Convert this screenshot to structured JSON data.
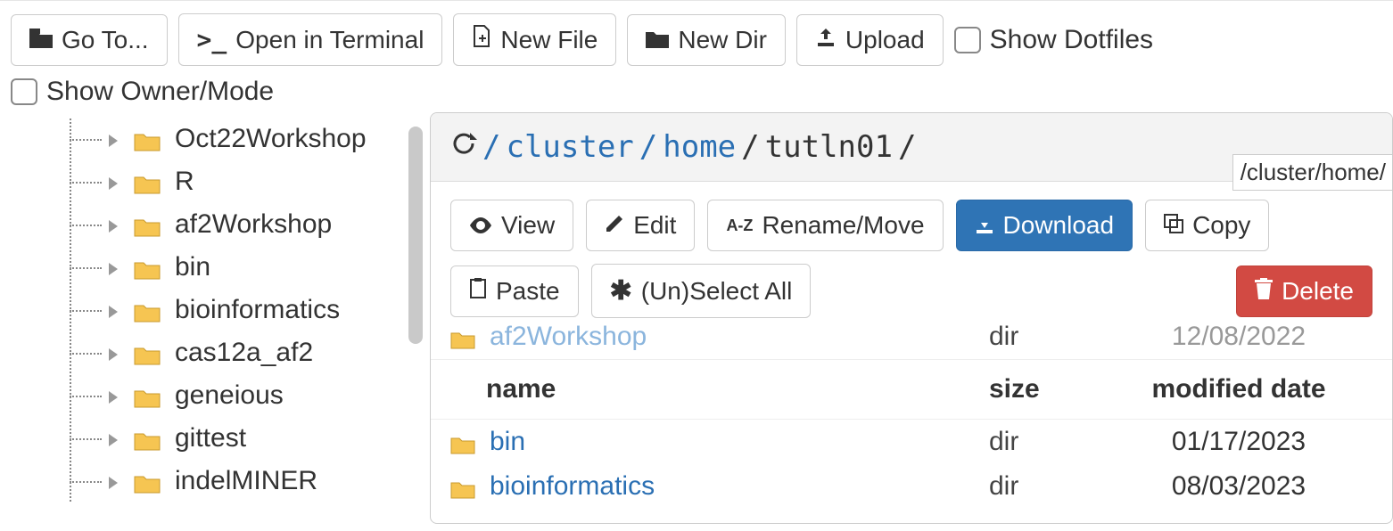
{
  "toolbar": {
    "goto": "Go To...",
    "terminal": "Open in Terminal",
    "newfile": "New File",
    "newdir": "New Dir",
    "upload": "Upload",
    "show_dotfiles": "Show Dotfiles",
    "show_ownermode": "Show Owner/Mode"
  },
  "tree": {
    "items": [
      "Oct22Workshop",
      "R",
      "af2Workshop",
      "bin",
      "bioinformatics",
      "cas12a_af2",
      "geneious",
      "gittest",
      "indelMINER"
    ]
  },
  "breadcrumb": {
    "parts": [
      "/",
      "cluster",
      "/",
      "home",
      "/",
      "tutln01",
      "/"
    ],
    "tooltip": "/cluster/home/"
  },
  "actions": {
    "view": "View",
    "edit": "Edit",
    "rename": "Rename/Move",
    "download": "Download",
    "copy": "Copy",
    "paste": "Paste",
    "selectall": "(Un)Select All",
    "delete": "Delete"
  },
  "table": {
    "headers": {
      "name": "name",
      "size": "size",
      "date": "modified date"
    },
    "rows": [
      {
        "name": "af2Workshop",
        "size": "dir",
        "date": "12/08/2022"
      },
      {
        "name": "bin",
        "size": "dir",
        "date": "01/17/2023"
      },
      {
        "name": "bioinformatics",
        "size": "dir",
        "date": "08/03/2023"
      }
    ]
  }
}
